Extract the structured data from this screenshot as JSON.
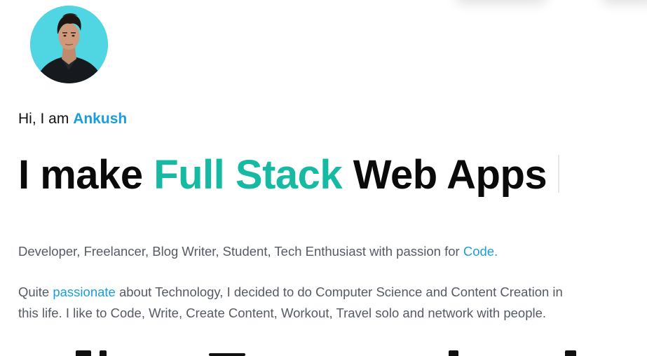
{
  "profile": {
    "avatar_icon": "profile-photo",
    "avatar_bg": "#4fd6e2"
  },
  "hero": {
    "greeting_prefix": "Hi, I am ",
    "greeting_name": "Ankush",
    "headline_prefix": "I make ",
    "headline_accent": "Full Stack",
    "headline_suffix": " Web Apps"
  },
  "intro": {
    "text": "Developer, Freelancer, Blog Writer, Student, Tech Enthusiast with passion for ",
    "link": "Code."
  },
  "about": {
    "prefix": "Quite ",
    "link": "passionate",
    "rest_line1": " about Technology, I decided to do Computer Science and Content Creation in",
    "line2": "this life. I like to Code, Write, Create Content, Workout, Travel solo and network with people."
  },
  "colors": {
    "link": "#1a9edb",
    "accent": "#16b9a2",
    "heading": "#0a0a0a",
    "body": "#555b64"
  }
}
